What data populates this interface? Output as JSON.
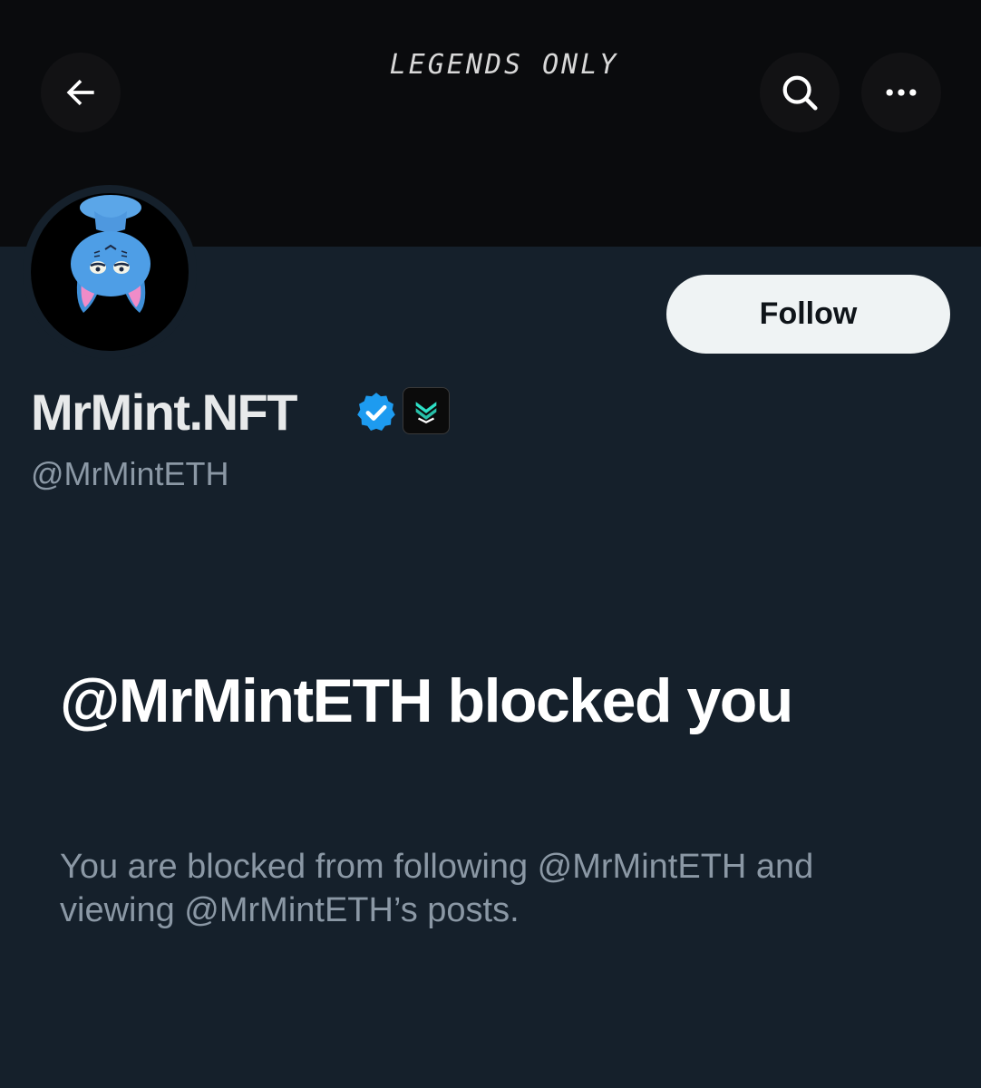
{
  "banner": {
    "text": "LEGENDS ONLY"
  },
  "header": {
    "back_icon": "arrow-left-icon",
    "search_icon": "search-icon",
    "more_icon": "more-horizontal-icon"
  },
  "profile": {
    "display_name": "MrMint.NFT",
    "handle": "@MrMintETH",
    "verified_color": "#1d9bf0",
    "affiliate_badge_color": "#2de0c6"
  },
  "actions": {
    "follow_label": "Follow"
  },
  "blocked": {
    "title": "@MrMintETH blocked you",
    "description": "You are blocked from following @MrMintETH and viewing @MrMintETH’s posts."
  }
}
